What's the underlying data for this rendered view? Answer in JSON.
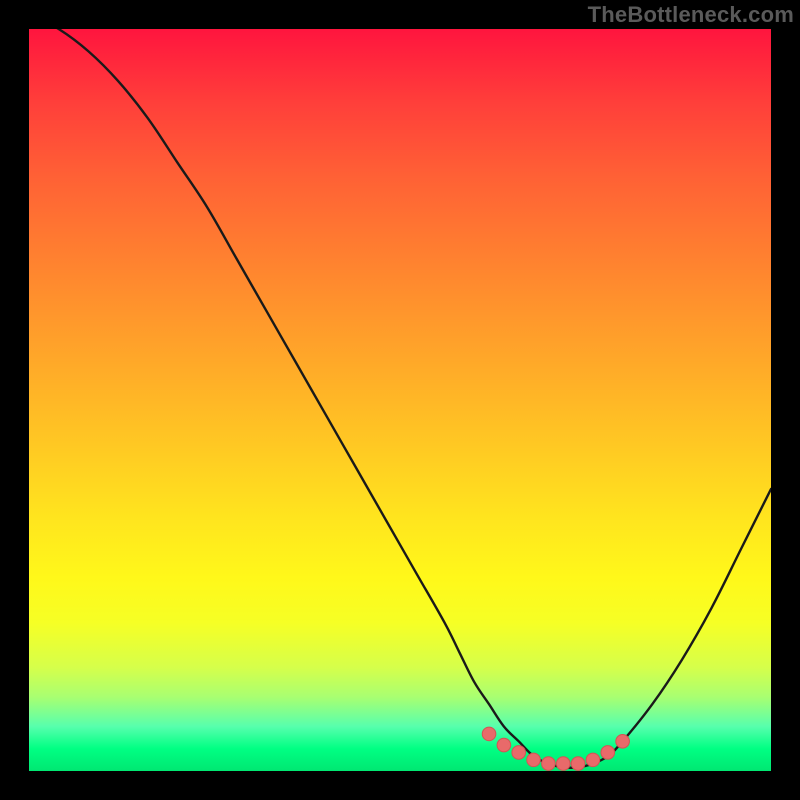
{
  "watermark": "TheBottleneck.com",
  "colors": {
    "background": "#000000",
    "curve": "#1a1a1a",
    "marker_fill": "#e86a6a",
    "marker_stroke": "#d35454",
    "gradient_top": "#ff153e",
    "gradient_bottom": "#00e772"
  },
  "chart_data": {
    "type": "line",
    "title": "",
    "xlabel": "",
    "ylabel": "",
    "xlim": [
      0,
      100
    ],
    "ylim": [
      0,
      100
    ],
    "series": [
      {
        "name": "bottleneck-curve",
        "x": [
          0,
          4,
          8,
          12,
          16,
          20,
          24,
          28,
          32,
          36,
          40,
          44,
          48,
          52,
          56,
          58,
          60,
          62,
          64,
          66,
          68,
          70,
          72,
          74,
          76,
          78,
          80,
          84,
          88,
          92,
          96,
          100
        ],
        "values": [
          102,
          100,
          97,
          93,
          88,
          82,
          76,
          69,
          62,
          55,
          48,
          41,
          34,
          27,
          20,
          16,
          12,
          9,
          6,
          4,
          2,
          1,
          0.5,
          0.5,
          1,
          2,
          4,
          9,
          15,
          22,
          30,
          38
        ]
      }
    ],
    "annotations": [
      {
        "name": "optimal-range-markers",
        "x": [
          62,
          64,
          66,
          68,
          70,
          72,
          74,
          76,
          78,
          80
        ],
        "values": [
          5,
          3.5,
          2.5,
          1.5,
          1,
          1,
          1,
          1.5,
          2.5,
          4
        ]
      }
    ],
    "grid": false,
    "legend_position": "none"
  }
}
